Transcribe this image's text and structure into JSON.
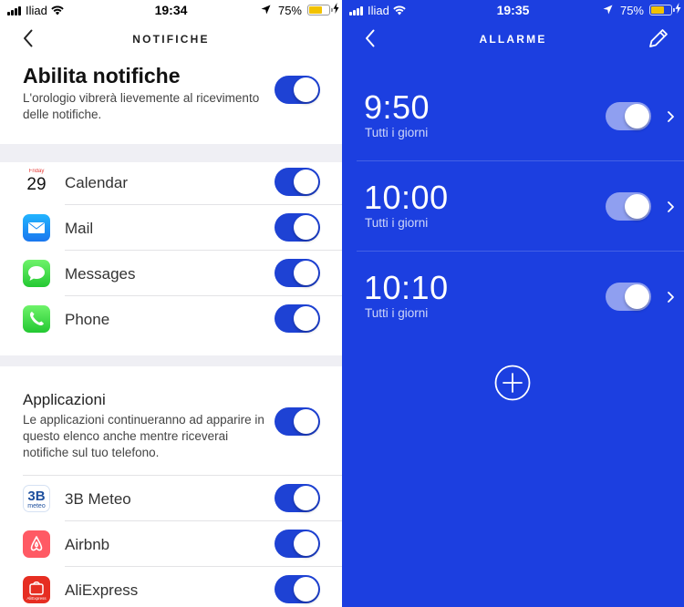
{
  "left": {
    "status": {
      "carrier": "Iliad",
      "time": "19:34",
      "battery": "75%"
    },
    "header": {
      "title": "NOTIFICHE"
    },
    "enable": {
      "title": "Abilita notifiche",
      "description": "L'orologio vibrerà lievemente al ricevimento delle notifiche.",
      "on": true
    },
    "system_apps": [
      {
        "label": "Calendar",
        "icon": "calendar-icon",
        "on": true
      },
      {
        "label": "Mail",
        "icon": "mail-icon",
        "on": true
      },
      {
        "label": "Messages",
        "icon": "messages-icon",
        "on": true
      },
      {
        "label": "Phone",
        "icon": "phone-icon",
        "on": true
      }
    ],
    "calendar_icon": {
      "day_name": "Friday",
      "day_number": "29"
    },
    "applications": {
      "title": "Applicazioni",
      "description": "Le applicazioni continueranno ad apparire in questo elenco anche mentre riceverai notifiche sul tuo telefono.",
      "on": true
    },
    "third_party_apps": [
      {
        "label": "3B Meteo",
        "icon": "3b-meteo-icon",
        "on": true,
        "icon_text": "3B",
        "icon_subtext": "meteo"
      },
      {
        "label": "Airbnb",
        "icon": "airbnb-icon",
        "on": true
      },
      {
        "label": "AliExpress",
        "icon": "aliexpress-icon",
        "on": true,
        "icon_subtext": "AliExpress"
      }
    ]
  },
  "right": {
    "status": {
      "carrier": "Iliad",
      "time": "19:35",
      "battery": "75%"
    },
    "header": {
      "title": "ALLARME"
    },
    "alarms": [
      {
        "time": "9:50",
        "repeat": "Tutti i giorni",
        "on": true
      },
      {
        "time": "10:00",
        "repeat": "Tutti i giorni",
        "on": true
      },
      {
        "time": "10:10",
        "repeat": "Tutti i giorni",
        "on": true
      }
    ]
  },
  "colors": {
    "accent_blue": "#1e42d4",
    "alarm_background": "#1c3fe0",
    "battery_yellow": "#f2c200"
  }
}
